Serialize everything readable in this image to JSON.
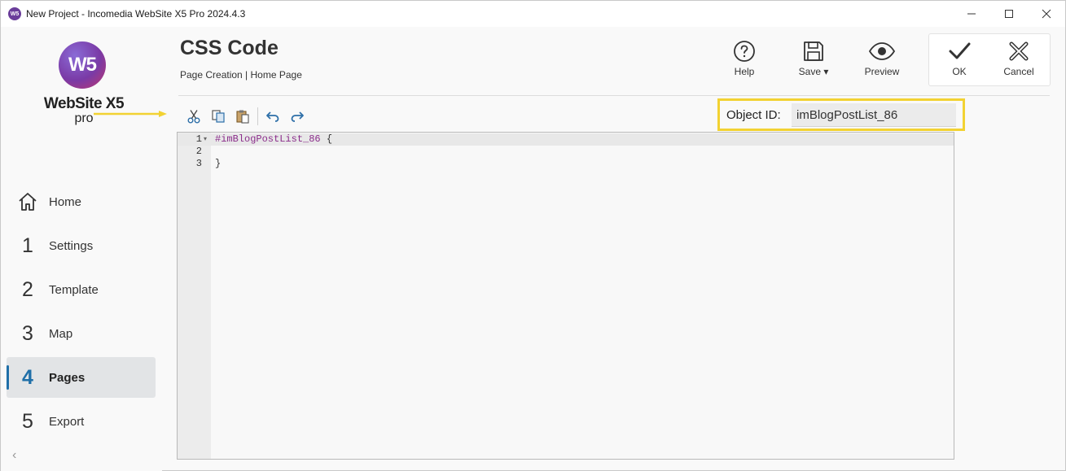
{
  "window": {
    "title": "New Project - Incomedia WebSite X5 Pro 2024.4.3",
    "app_icon_text": "W5"
  },
  "logo": {
    "mark": "W5",
    "name": "WebSite X5",
    "edition": "pro"
  },
  "sidebar": {
    "items": [
      {
        "num": "",
        "icon": "home-icon",
        "label": "Home",
        "active": false
      },
      {
        "num": "1",
        "label": "Settings",
        "active": false
      },
      {
        "num": "2",
        "label": "Template",
        "active": false
      },
      {
        "num": "3",
        "label": "Map",
        "active": false
      },
      {
        "num": "4",
        "label": "Pages",
        "active": true
      },
      {
        "num": "5",
        "label": "Export",
        "active": false
      }
    ],
    "collapse_glyph": "‹"
  },
  "header": {
    "title": "CSS Code",
    "breadcrumb": "Page Creation | Home Page"
  },
  "toolbar": {
    "help": "Help",
    "save": "Save ▾",
    "preview": "Preview",
    "ok": "OK",
    "cancel": "Cancel"
  },
  "edit_toolbar": {
    "icons": [
      "cut-icon",
      "copy-icon",
      "paste-icon",
      "undo-icon",
      "redo-icon"
    ]
  },
  "object_id": {
    "label": "Object ID:",
    "value": "imBlogPostList_86"
  },
  "editor": {
    "lines": [
      {
        "num": "1",
        "selector": "#imBlogPostList_86",
        "rest": " {",
        "foldable": true,
        "current": true
      },
      {
        "num": "2",
        "selector": "",
        "rest": "",
        "foldable": false,
        "current": false
      },
      {
        "num": "3",
        "selector": "",
        "rest": "}",
        "foldable": false,
        "current": false
      }
    ]
  },
  "colors": {
    "highlight_border": "#f2d232",
    "accent": "#1f6fa8",
    "selector_text": "#8b2d8b",
    "arrow": "#f2d232"
  }
}
